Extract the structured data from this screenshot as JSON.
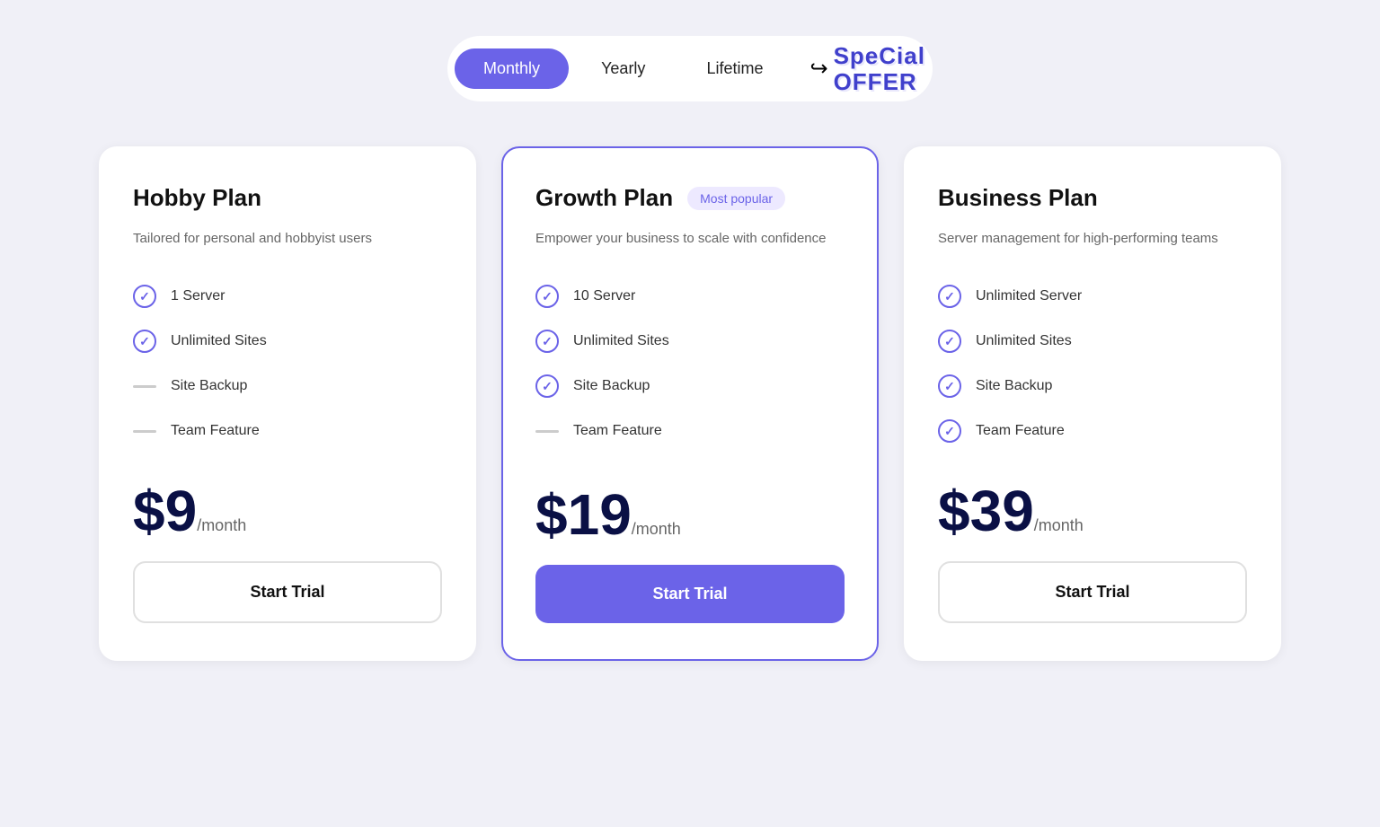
{
  "billing": {
    "tabs": [
      {
        "id": "monthly",
        "label": "Monthly",
        "active": true
      },
      {
        "id": "yearly",
        "label": "Yearly",
        "active": false
      },
      {
        "id": "lifetime",
        "label": "Lifetime",
        "active": false
      }
    ],
    "special_offer_line1": "SpeCial",
    "special_offer_line2": "OFFER"
  },
  "plans": [
    {
      "id": "hobby",
      "name": "Hobby Plan",
      "description": "Tailored for personal and hobbyist users",
      "featured": false,
      "badge": null,
      "features": [
        {
          "label": "1 Server",
          "included": true
        },
        {
          "label": "Unlimited Sites",
          "included": true
        },
        {
          "label": "Site Backup",
          "included": false
        },
        {
          "label": "Team Feature",
          "included": false
        }
      ],
      "price": "$9",
      "period": "/month",
      "cta": "Start Trial"
    },
    {
      "id": "growth",
      "name": "Growth Plan",
      "description": "Empower your business to scale with confidence",
      "featured": true,
      "badge": "Most popular",
      "features": [
        {
          "label": "10 Server",
          "included": true
        },
        {
          "label": "Unlimited Sites",
          "included": true
        },
        {
          "label": "Site Backup",
          "included": true
        },
        {
          "label": "Team Feature",
          "included": false
        }
      ],
      "price": "$19",
      "period": "/month",
      "cta": "Start Trial"
    },
    {
      "id": "business",
      "name": "Business Plan",
      "description": "Server management for high-performing teams",
      "featured": false,
      "badge": null,
      "features": [
        {
          "label": "Unlimited Server",
          "included": true
        },
        {
          "label": "Unlimited Sites",
          "included": true
        },
        {
          "label": "Site Backup",
          "included": true
        },
        {
          "label": "Team Feature",
          "included": true
        }
      ],
      "price": "$39",
      "period": "/month",
      "cta": "Start Trial"
    }
  ]
}
